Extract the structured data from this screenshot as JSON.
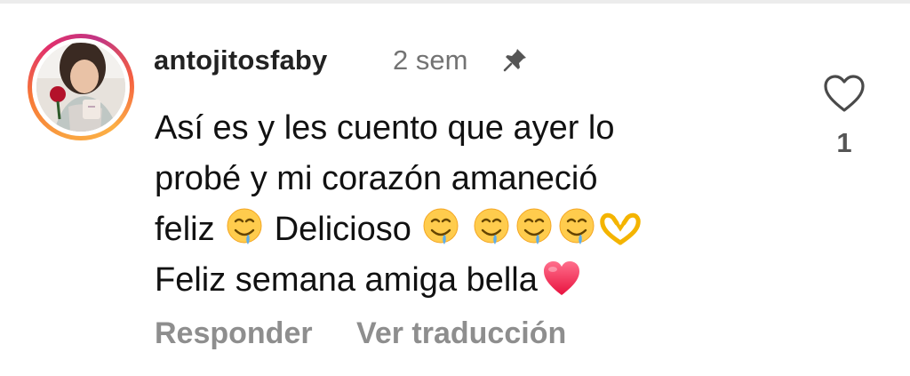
{
  "comment": {
    "username": "antojitosfaby",
    "timestamp": "2 sem",
    "body_lines": [
      "Así es y les cuento que ayer lo",
      "probé y mi corazón amaneció",
      "feliz",
      "Delicioso",
      "Feliz semana amiga bella"
    ],
    "emojis": {
      "drooling": "drooling-face",
      "hands": "heart-hands",
      "heart": "red-heart"
    },
    "actions": {
      "reply_label": "Responder",
      "translate_label": "Ver traducción"
    },
    "likes": "1",
    "icons": {
      "pin": "pin-icon",
      "like": "heart-outline-icon"
    },
    "colors": {
      "text": "#111111",
      "muted": "#8e8e8e",
      "ring_start": "#f9a03f",
      "ring_end": "#c13584"
    }
  }
}
